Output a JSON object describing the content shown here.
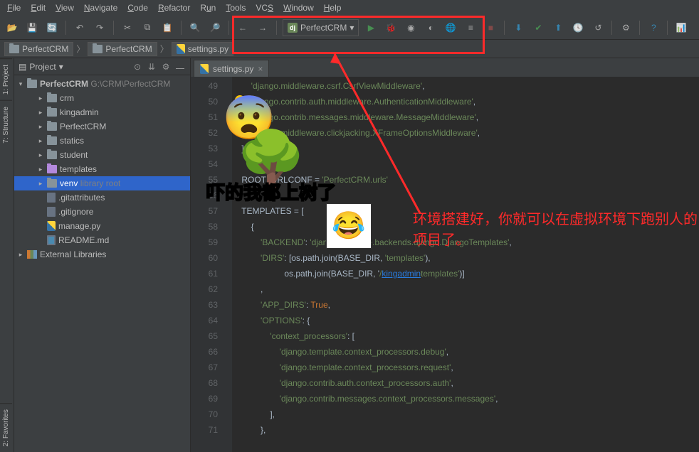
{
  "menu": {
    "items": [
      "File",
      "Edit",
      "View",
      "Navigate",
      "Code",
      "Refactor",
      "Run",
      "Tools",
      "VCS",
      "Window",
      "Help"
    ]
  },
  "toolbar": {
    "run_config": "PerfectCRM",
    "icons": [
      "open-icon",
      "save-all-icon",
      "sync-icon",
      "undo-icon",
      "redo-icon",
      "cut-icon",
      "copy-icon",
      "paste-icon",
      "find-icon",
      "replace-icon",
      "back-icon",
      "forward-icon",
      "run-icon",
      "debug-icon",
      "coverage-icon",
      "profile-icon",
      "attach-icon",
      "stop-icon",
      "vcs-update-icon",
      "vcs-commit-icon",
      "vcs-push-icon",
      "vcs-history-icon",
      "revert-icon",
      "settings-icon",
      "help-icon",
      "sci-mode-icon"
    ]
  },
  "breadcrumb": {
    "items": [
      "PerfectCRM",
      "PerfectCRM",
      "settings.py"
    ]
  },
  "project": {
    "label": "Project",
    "root": {
      "name": "PerfectCRM",
      "path": "G:\\CRM\\PerfectCRM"
    },
    "tree": [
      {
        "name": "crm",
        "type": "folder",
        "indent": 2,
        "expand": true
      },
      {
        "name": "kingadmin",
        "type": "folder",
        "indent": 2,
        "expand": true
      },
      {
        "name": "PerfectCRM",
        "type": "folder",
        "indent": 2,
        "expand": true
      },
      {
        "name": "statics",
        "type": "folder",
        "indent": 2,
        "expand": true
      },
      {
        "name": "student",
        "type": "folder",
        "indent": 2,
        "expand": true
      },
      {
        "name": "templates",
        "type": "folder-purple",
        "indent": 2,
        "expand": true
      },
      {
        "name": "venv",
        "note": "library root",
        "type": "folder",
        "indent": 2,
        "expand": true,
        "sel": true
      },
      {
        "name": ".gitattributes",
        "type": "file",
        "indent": 2
      },
      {
        "name": ".gitignore",
        "type": "file",
        "indent": 2
      },
      {
        "name": "manage.py",
        "type": "py",
        "indent": 2
      },
      {
        "name": "README.md",
        "type": "md",
        "indent": 2
      }
    ],
    "ext": "External Libraries"
  },
  "tabs": {
    "open": [
      {
        "name": "settings.py"
      }
    ]
  },
  "code": {
    "lines": [
      {
        "n": 49,
        "pre": "        ",
        "t": "'",
        "s": "django.middleware.csrf.CsrfViewMiddleware",
        "t2": "',"
      },
      {
        "n": 50,
        "pre": "        ",
        "t": "'",
        "s": "django.contrib.auth.middleware.AuthenticationMiddleware",
        "t2": "',",
        "bulb": true
      },
      {
        "n": 51,
        "pre": "        ",
        "t": "'",
        "s": "django.contrib.messages.middleware.MessageMiddleware",
        "t2": "',"
      },
      {
        "n": 52,
        "pre": "        ",
        "t": "'",
        "s": "django.middleware.clickjacking.XFrameOptionsMiddleware",
        "t2": "',"
      },
      {
        "n": 53,
        "pre": "    ]"
      },
      {
        "n": 54,
        "pre": ""
      },
      {
        "n": 55,
        "pre": "    ROOT_URLCONF = ",
        "t": "'",
        "s": "PerfectCRM.urls",
        "t2": "'"
      },
      {
        "n": 56,
        "pre": ""
      },
      {
        "n": 57,
        "pre": "    TEMPLATES = ["
      },
      {
        "n": 58,
        "pre": "        {"
      },
      {
        "n": 59,
        "pre": "            ",
        "t": "'",
        "s": "BACKEND",
        "t2": "': '",
        "s2": "django.template.backends.django.DjangoTemplates",
        "t3": "',"
      },
      {
        "n": 60,
        "pre": "            ",
        "t": "'",
        "s": "DIRS",
        "t2": "': [os.path.join(BASE_DIR, '",
        "s2": "templates",
        "t3": "'),"
      },
      {
        "n": 61,
        "pre": "                      os.path.join(BASE_DIR, '",
        "link": "kingadmin",
        "t2": "/",
        "s2": "templates",
        "t3": "')]"
      },
      {
        "n": 62,
        "pre": "            ,"
      },
      {
        "n": 63,
        "pre": "            ",
        "t": "'",
        "s": "APP_DIRS",
        "t2": "': ",
        "k": "True",
        "t3": ","
      },
      {
        "n": 64,
        "pre": "            ",
        "t": "'",
        "s": "OPTIONS",
        "t2": "': {"
      },
      {
        "n": 65,
        "pre": "                ",
        "t": "'",
        "s": "context_processors",
        "t2": "': ["
      },
      {
        "n": 66,
        "pre": "                    ",
        "t": "'",
        "s": "django.template.context_processors.debug",
        "t2": "',"
      },
      {
        "n": 67,
        "pre": "                    ",
        "t": "'",
        "s": "django.template.context_processors.request",
        "t2": "',"
      },
      {
        "n": 68,
        "pre": "                    ",
        "t": "'",
        "s": "django.contrib.auth.context_processors.auth",
        "t2": "',"
      },
      {
        "n": 69,
        "pre": "                    ",
        "t": "'",
        "s": "django.contrib.messages.context_processors.messages",
        "t2": "',"
      },
      {
        "n": 70,
        "pre": "                ],"
      },
      {
        "n": 71,
        "pre": "            },"
      }
    ]
  },
  "sidebars": {
    "left": [
      "1: Project",
      "7: Structure",
      "2: Favorites"
    ]
  },
  "annotations": {
    "red_text": "环境搭建好，你就可以在虚拟环境下跑别人的项目了。",
    "sticker1_text": "吓的我都上树了"
  }
}
